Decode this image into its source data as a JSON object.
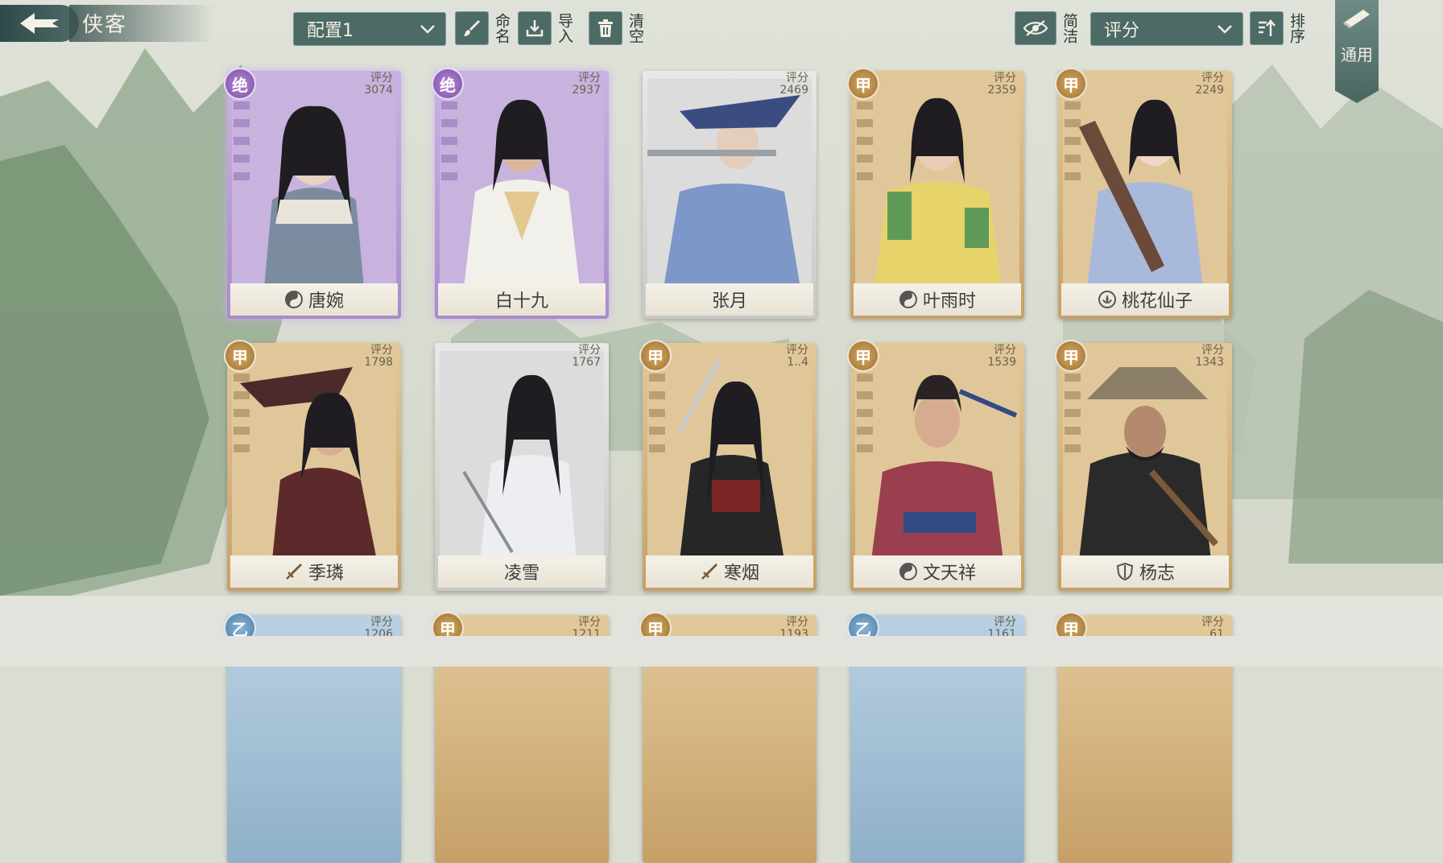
{
  "header": {
    "title": "侠客",
    "config_select": "配置1",
    "rename_label": "命名",
    "import_label": "导入",
    "clear_label": "清空",
    "simple_label": "简洁",
    "sort_select": "评分",
    "sort_label": "排序",
    "common_tag": "通用"
  },
  "score_label": "评分",
  "cards": [
    {
      "name": "唐婉",
      "score": "3074",
      "rank": "绝",
      "faction_icon": "taiji-icon"
    },
    {
      "name": "白十九",
      "score": "2937",
      "rank": "绝",
      "faction_icon": ""
    },
    {
      "name": "张月",
      "score": "2469",
      "rank": "",
      "faction_icon": ""
    },
    {
      "name": "叶雨时",
      "score": "2359",
      "rank": "甲",
      "faction_icon": "taiji-icon"
    },
    {
      "name": "桃花仙子",
      "score": "2249",
      "rank": "甲",
      "faction_icon": "lotus-icon"
    },
    {
      "name": "季璘",
      "score": "1798",
      "rank": "甲",
      "faction_icon": "sword-icon"
    },
    {
      "name": "凌雪",
      "score": "1767",
      "rank": "",
      "faction_icon": ""
    },
    {
      "name": "寒烟",
      "score": "1..4",
      "rank": "甲",
      "faction_icon": "sword-icon"
    },
    {
      "name": "文天祥",
      "score": "1539",
      "rank": "甲",
      "faction_icon": "taiji-icon"
    },
    {
      "name": "杨志",
      "score": "1343",
      "rank": "甲",
      "faction_icon": "shield-icon"
    }
  ],
  "partial_row": [
    {
      "rank": "乙",
      "score": "1206"
    },
    {
      "rank": "甲",
      "score": "1211"
    },
    {
      "rank": "甲",
      "score": "1193"
    },
    {
      "rank": "乙",
      "score": "1161"
    },
    {
      "rank": "甲",
      "score": "..61"
    }
  ],
  "colors": {
    "accent": "#4c6a66",
    "jue": "#9b6fc6",
    "jia": "#c9a262",
    "yi": "#6f9fc4"
  }
}
